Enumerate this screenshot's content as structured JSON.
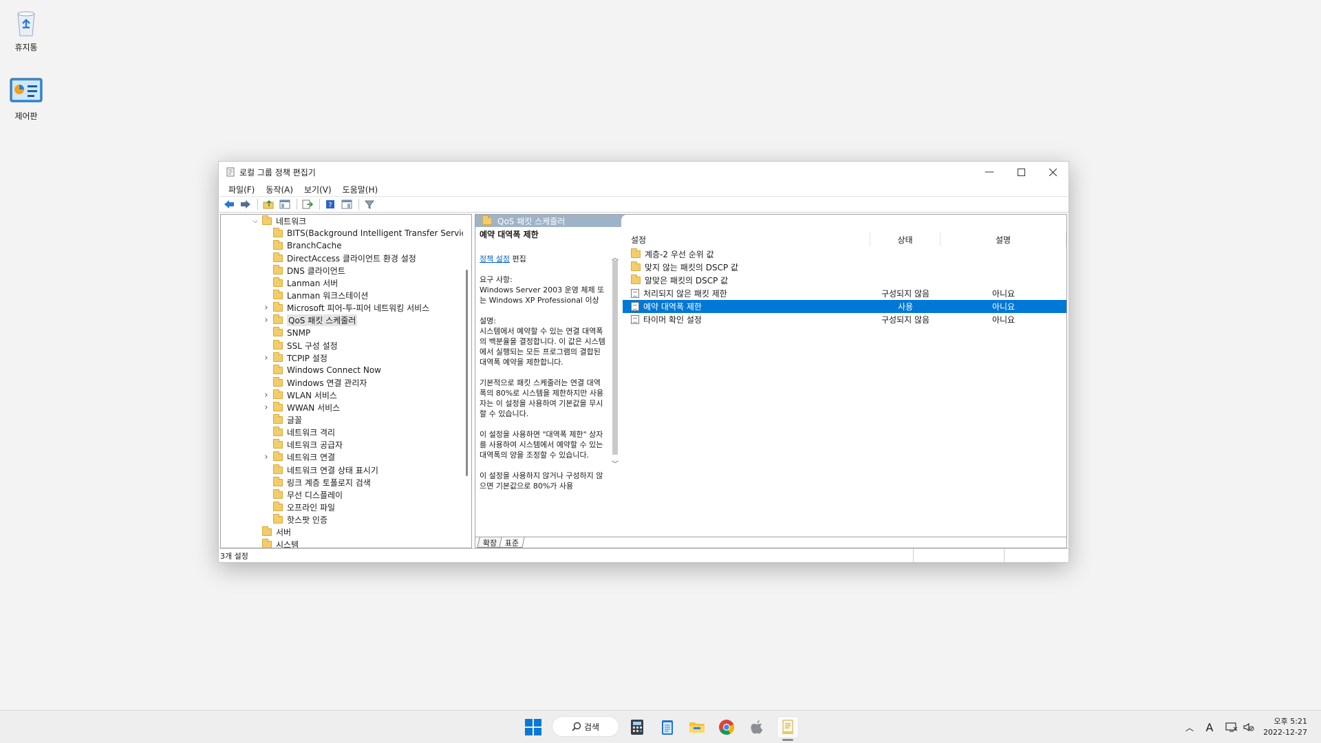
{
  "desktop": {
    "icons": [
      {
        "label": "휴지통"
      },
      {
        "label": "제어판"
      }
    ]
  },
  "window": {
    "title": "로컬 그룹 정책 편집기",
    "menu": [
      "파일(F)",
      "동작(A)",
      "보기(V)",
      "도움말(H)"
    ],
    "tree": {
      "root_label": "네트워크",
      "items": [
        {
          "label": "BITS(Background Intelligent Transfer Service)",
          "expandable": false
        },
        {
          "label": "BranchCache",
          "expandable": false
        },
        {
          "label": "DirectAccess 클라이언트 환경 설정",
          "expandable": false
        },
        {
          "label": "DNS 클라이언트",
          "expandable": false
        },
        {
          "label": "Lanman 서버",
          "expandable": false
        },
        {
          "label": "Lanman 워크스테이션",
          "expandable": false
        },
        {
          "label": "Microsoft 피어-투-피어 네트워킹 서비스",
          "expandable": true
        },
        {
          "label": "QoS 패킷 스케줄러",
          "expandable": true,
          "selected": true
        },
        {
          "label": "SNMP",
          "expandable": false
        },
        {
          "label": "SSL 구성 설정",
          "expandable": false
        },
        {
          "label": "TCPIP 설정",
          "expandable": true
        },
        {
          "label": "Windows Connect Now",
          "expandable": false
        },
        {
          "label": "Windows 연결 관리자",
          "expandable": false
        },
        {
          "label": "WLAN 서비스",
          "expandable": true
        },
        {
          "label": "WWAN 서비스",
          "expandable": true
        },
        {
          "label": "글꼴",
          "expandable": false
        },
        {
          "label": "네트워크 격리",
          "expandable": false
        },
        {
          "label": "네트워크 공급자",
          "expandable": false
        },
        {
          "label": "네트워크 연결",
          "expandable": true
        },
        {
          "label": "네트워크 연결 상태 표시기",
          "expandable": false
        },
        {
          "label": "링크 계층 토폴로지 검색",
          "expandable": false
        },
        {
          "label": "무선 디스플레이",
          "expandable": false
        },
        {
          "label": "오프라인 파일",
          "expandable": false
        },
        {
          "label": "핫스팟 인증",
          "expandable": false
        }
      ],
      "after_items": [
        "서버",
        "시스템"
      ]
    },
    "right": {
      "header": "QoS 패킷 스케줄러",
      "description": {
        "title": "예약 대역폭 제한",
        "edit_link": "정책 설정",
        "edit_suffix": " 편집",
        "requirements": "요구 사항:\nWindows Server 2003 운영 체제 또는 Windows XP Professional 이상",
        "desc1": "설명:\n시스템에서 예약할 수 있는 연결 대역폭의 백분율을 결정합니다. 이 값은 시스템에서 실행되는 모든 프로그램의 결합된 대역폭 예약을 제한합니다.",
        "desc2": "기본적으로 패킷 스케줄러는 연결 대역폭의 80%로 시스템을 제한하지만 사용자는 이 설정을 사용하여 기본값을 무시할 수 있습니다.",
        "desc3": "이 설정을 사용하면 \"대역폭 제한\" 상자를 사용하여 시스템에서 예약할 수 있는 대역폭의 양을 조정할 수 있습니다.",
        "desc4": "이 설정을 사용하지 않거나 구성하지 않으면 기본값으로 80%가 사용"
      },
      "columns": [
        "설정",
        "상태",
        "설명"
      ],
      "rows": [
        {
          "kind": "folder",
          "name": "계층-2 우선 순위 값",
          "state": "",
          "comment": ""
        },
        {
          "kind": "folder",
          "name": "맞지 않는 패킷의 DSCP 값",
          "state": "",
          "comment": ""
        },
        {
          "kind": "folder",
          "name": "알맞은 패킷의 DSCP 값",
          "state": "",
          "comment": ""
        },
        {
          "kind": "policy",
          "name": "처리되지 않은 패킷 제한",
          "state": "구성되지 않음",
          "comment": "아니요"
        },
        {
          "kind": "policy",
          "name": "예약 대역폭 제한",
          "state": "사용",
          "comment": "아니요",
          "selected": true
        },
        {
          "kind": "policy",
          "name": "타이머 확인 설정",
          "state": "구성되지 않음",
          "comment": "아니요"
        }
      ],
      "tabs": [
        "확장",
        "표준"
      ]
    },
    "status": "3개 설정"
  },
  "taskbar": {
    "search_label": "검색",
    "tray_language": "A",
    "clock_time": "오후 5:21",
    "clock_date": "2022-12-27"
  },
  "colors": {
    "selection": "#0078d7",
    "pane_header": "#9fb3c8",
    "folder": "#f3cd6a"
  }
}
